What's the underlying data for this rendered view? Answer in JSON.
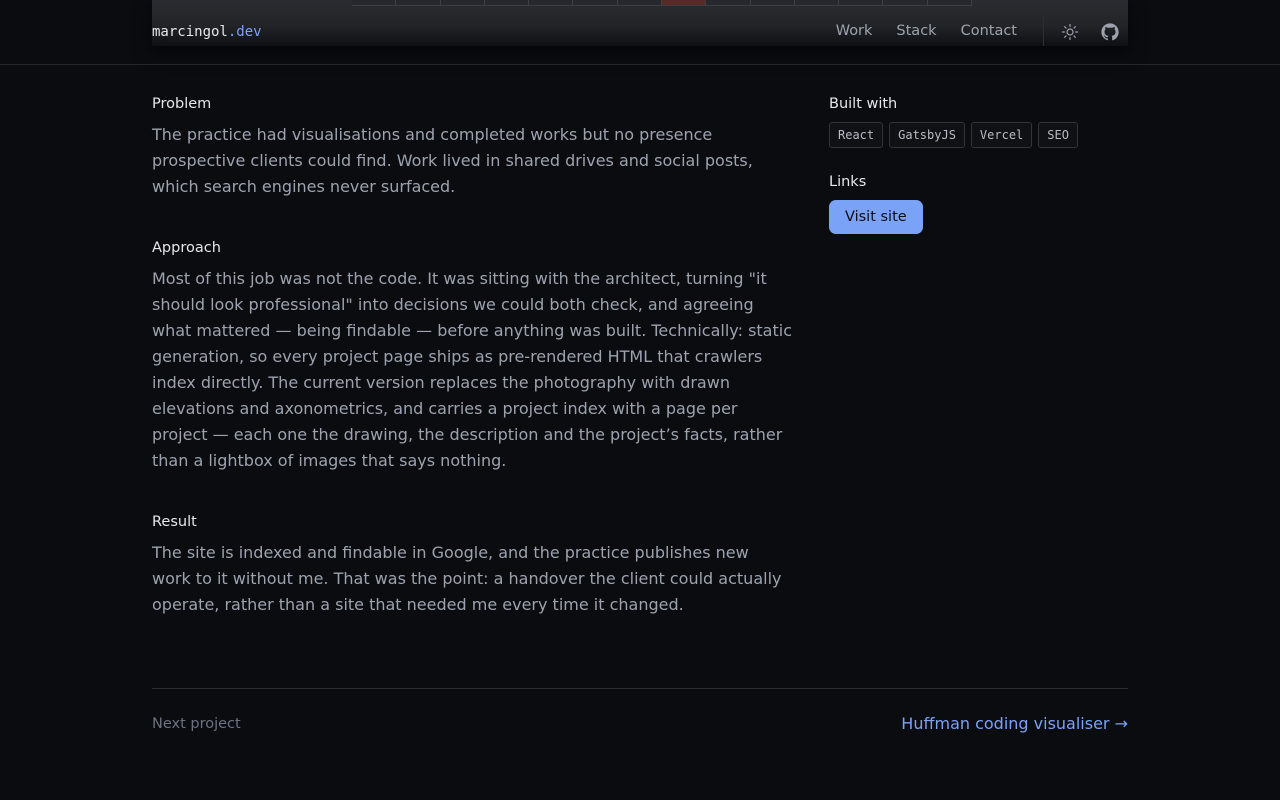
{
  "header": {
    "brand_name": "marcingol",
    "brand_tld": ".dev",
    "nav": [
      "Work",
      "Stack",
      "Contact"
    ],
    "icons": [
      "sun-icon",
      "github-icon"
    ]
  },
  "main": {
    "problem": {
      "heading": "Problem",
      "body": "The practice had visualisations and completed works but no presence prospective clients could find. Work lived in shared drives and social posts, which search engines never surfaced."
    },
    "approach": {
      "heading": "Approach",
      "body": "Most of this job was not the code. It was sitting with the architect, turning \"it should look professional\" into decisions we could both check, and agreeing what mattered — being findable — before anything was built. Technically: static generation, so every project page ships as pre-rendered HTML that crawlers index directly. The current version replaces the photography with drawn elevations and axonometrics, and carries a project index with a page per project — each one the drawing, the description and the project’s facts, rather than a lightbox of images that says nothing."
    },
    "result": {
      "heading": "Result",
      "body": "The site is indexed and findable in Google, and the practice publishes new work to it without me. That was the point: a handover the client could actually operate, rather than a site that needed me every time it changed."
    }
  },
  "sidebar": {
    "built_with_heading": "Built with",
    "tags": [
      "React",
      "GatsbyJS",
      "Vercel",
      "SEO"
    ],
    "links_heading": "Links",
    "visit_label": "Visit site"
  },
  "footer": {
    "next_label": "Next project",
    "next_link": "Huffman coding visualiser →"
  },
  "colors": {
    "background": "#0b0c10",
    "accent": "#7aa2f7",
    "text_primary": "#e5e7eb",
    "text_secondary": "#9ca3af"
  }
}
